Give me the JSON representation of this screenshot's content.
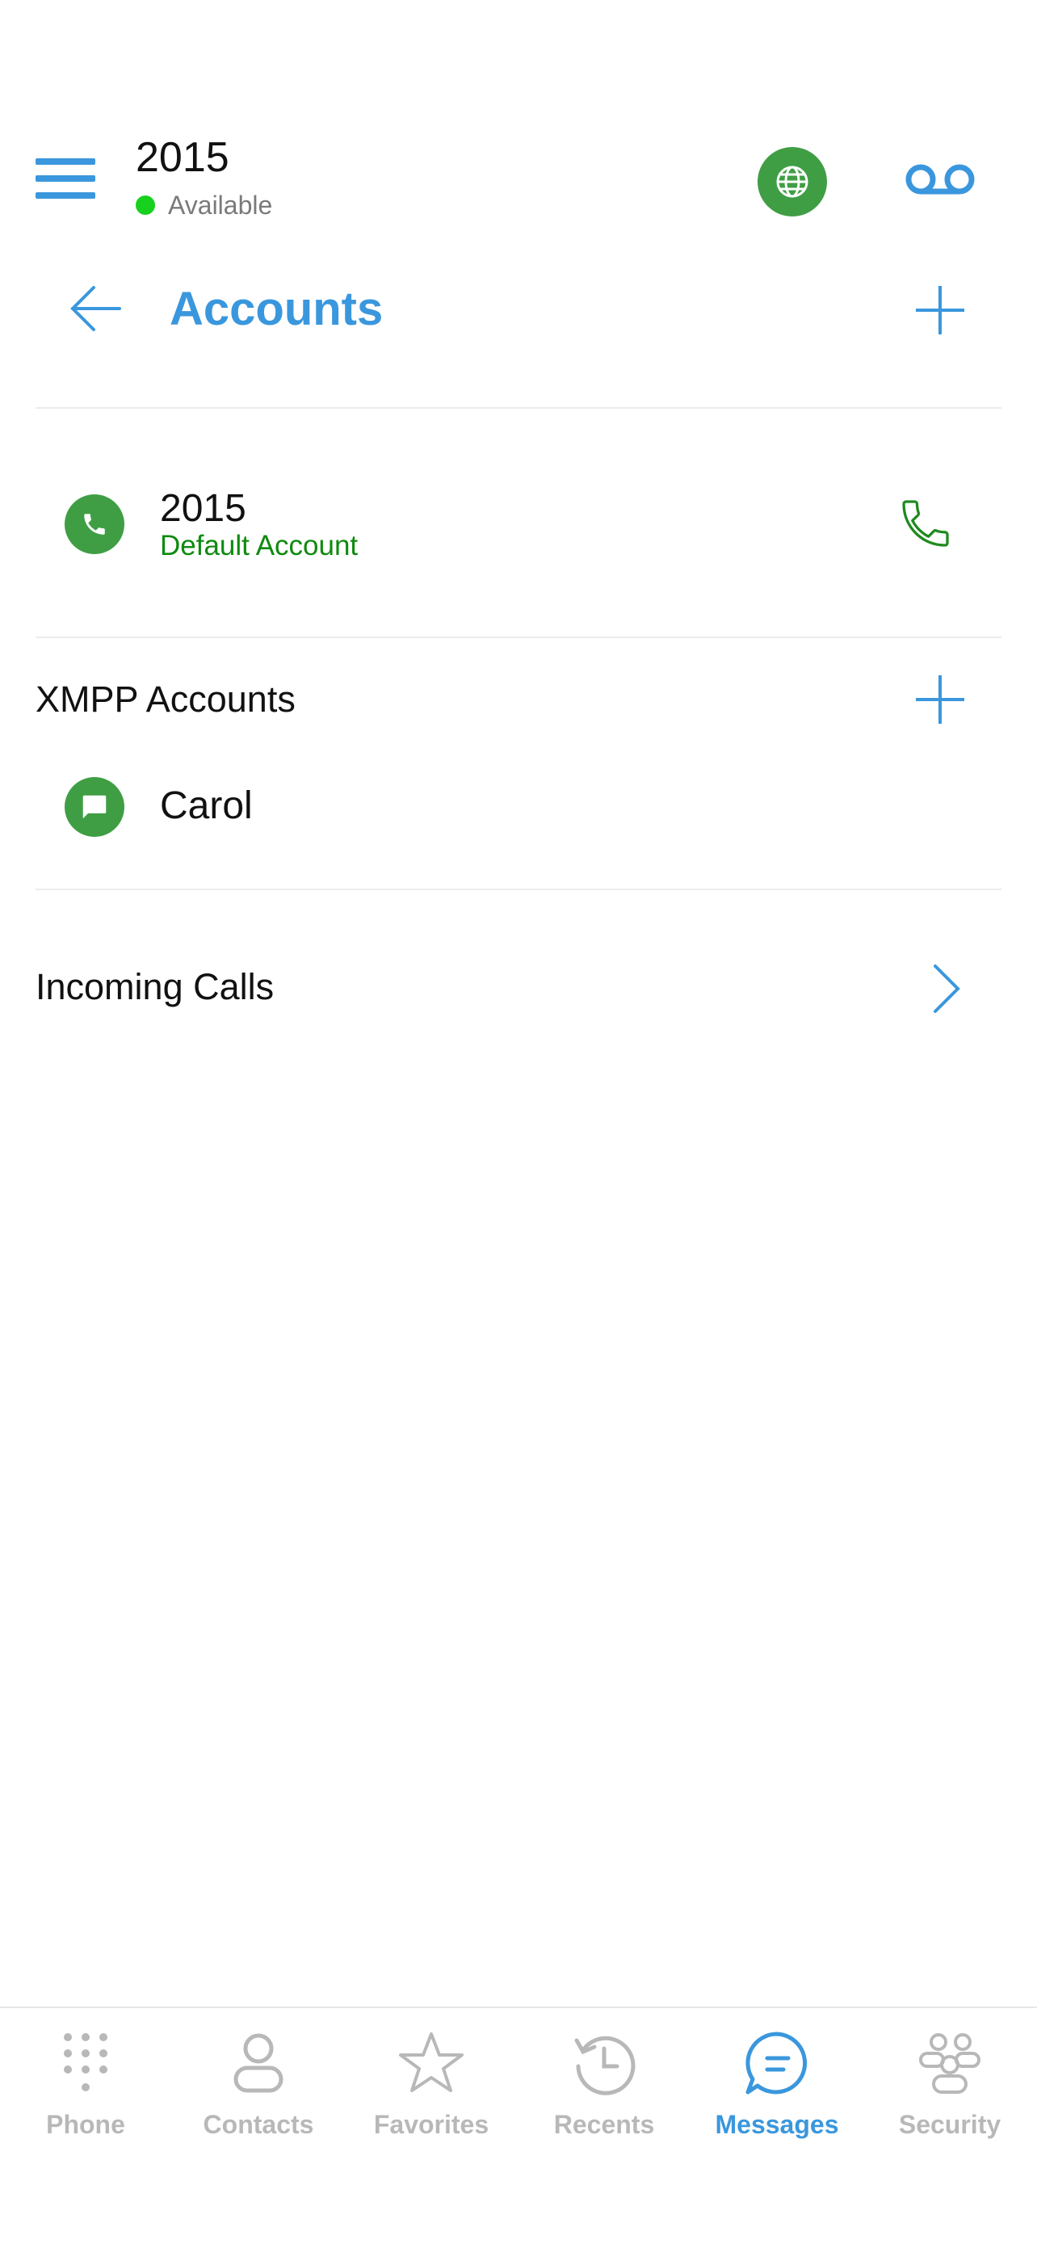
{
  "header": {
    "user_name": "2015",
    "status": "Available",
    "colors": {
      "accent": "#3a97dd",
      "online": "#18d11e",
      "green": "#3f9e44"
    }
  },
  "page": {
    "title": "Accounts"
  },
  "default_account": {
    "name": "2015",
    "subtitle": "Default Account"
  },
  "xmpp": {
    "section_title": "XMPP Accounts",
    "accounts": [
      {
        "name": "Carol"
      }
    ]
  },
  "incoming_calls": {
    "label": "Incoming Calls"
  },
  "bottom_nav": {
    "items": [
      {
        "label": "Phone",
        "icon": "dialpad-icon"
      },
      {
        "label": "Contacts",
        "icon": "person-icon"
      },
      {
        "label": "Favorites",
        "icon": "star-icon"
      },
      {
        "label": "Recents",
        "icon": "history-icon"
      },
      {
        "label": "Messages",
        "icon": "chat-bubble-icon",
        "active": true
      },
      {
        "label": "Security",
        "icon": "group-icon"
      }
    ]
  }
}
